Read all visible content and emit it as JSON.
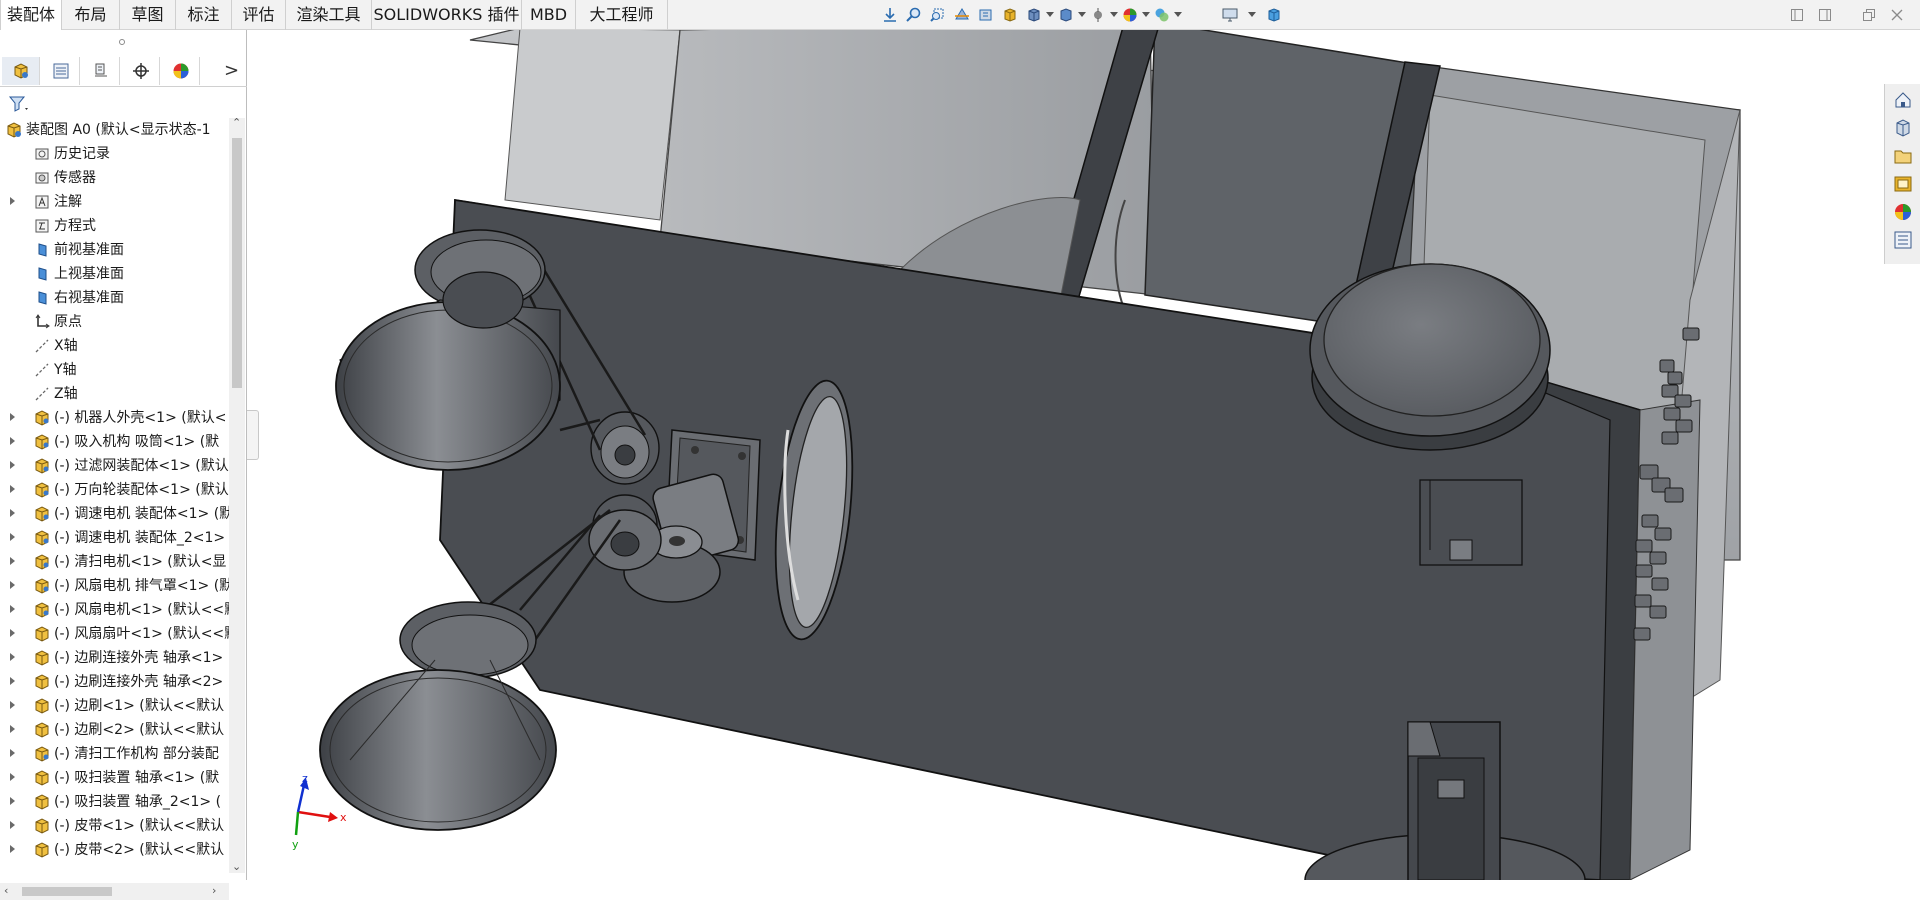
{
  "tabs": [
    {
      "label": "装配体",
      "active": true
    },
    {
      "label": "布局"
    },
    {
      "label": "草图"
    },
    {
      "label": "标注"
    },
    {
      "label": "评估"
    },
    {
      "label": "渲染工具"
    },
    {
      "label": "SOLIDWORKS 插件"
    },
    {
      "label": "MBD"
    },
    {
      "label": "大工程师"
    }
  ],
  "heads_up_toolbar": [
    "zoom-to-fit-icon",
    "zoom-to-area-icon",
    "previous-view-icon",
    "section-view-icon",
    "dynamic-annotation-icon",
    "view-orientation-icon",
    "display-style-icon",
    "hide-show-icon",
    "edit-appearance-icon",
    "apply-scene-icon",
    "view-settings-icon",
    "3d-view-icon"
  ],
  "window_controls": [
    "restore-icon",
    "tile-icon",
    "maximize-icon",
    "close-icon"
  ],
  "feature_manager": {
    "tab_icons": [
      "feature-manager-tree-icon",
      "property-manager-icon",
      "configuration-manager-icon",
      "dimxpert-icon",
      "display-manager-icon"
    ],
    "more_label": ">",
    "filter_icon": "filter-icon"
  },
  "tree": [
    {
      "label": "装配图 A0  (默认<显示状态-1",
      "icon": "assembly-icon",
      "level": 0
    },
    {
      "label": "历史记录",
      "icon": "history-icon",
      "level": 1
    },
    {
      "label": "传感器",
      "icon": "sensor-icon",
      "level": 1
    },
    {
      "label": "注解",
      "icon": "annotation-icon",
      "level": 1,
      "expandable": true
    },
    {
      "label": "方程式",
      "icon": "equation-icon",
      "level": 1
    },
    {
      "label": "前视基准面",
      "icon": "plane-icon",
      "level": 1
    },
    {
      "label": "上视基准面",
      "icon": "plane-icon",
      "level": 1
    },
    {
      "label": "右视基准面",
      "icon": "plane-icon",
      "level": 1
    },
    {
      "label": "原点",
      "icon": "origin-icon",
      "level": 1
    },
    {
      "label": "X轴",
      "icon": "axis-icon",
      "level": 1
    },
    {
      "label": "Y轴",
      "icon": "axis-icon",
      "level": 1
    },
    {
      "label": "Z轴",
      "icon": "axis-icon",
      "level": 1
    },
    {
      "label": "(-) 机器人外壳<1> (默认<",
      "icon": "subassembly-icon",
      "level": 1,
      "expandable": true
    },
    {
      "label": "(-) 吸入机构  吸筒<1> (默",
      "icon": "subassembly-icon",
      "level": 1,
      "expandable": true
    },
    {
      "label": "(-) 过滤网装配体<1> (默认",
      "icon": "subassembly-icon",
      "level": 1,
      "expandable": true
    },
    {
      "label": "(-) 万向轮装配体<1> (默认",
      "icon": "subassembly-icon",
      "level": 1,
      "expandable": true
    },
    {
      "label": "(-) 调速电机 装配体<1> (默",
      "icon": "subassembly-icon",
      "level": 1,
      "expandable": true
    },
    {
      "label": "(-) 调速电机 装配体_2<1>",
      "icon": "subassembly-icon",
      "level": 1,
      "expandable": true
    },
    {
      "label": "(-) 清扫电机<1> (默认<显",
      "icon": "subassembly-icon",
      "level": 1,
      "expandable": true
    },
    {
      "label": "(-) 风扇电机 排气罩<1> (默",
      "icon": "subassembly-icon",
      "level": 1,
      "expandable": true
    },
    {
      "label": "(-) 风扇电机<1> (默认<<默",
      "icon": "subassembly-icon",
      "level": 1,
      "expandable": true
    },
    {
      "label": "(-) 风扇扇叶<1> (默认<<默",
      "icon": "part-icon",
      "level": 1,
      "expandable": true
    },
    {
      "label": "(-) 边刷连接外壳 轴承<1>",
      "icon": "part-icon",
      "level": 1,
      "expandable": true
    },
    {
      "label": "(-) 边刷连接外壳 轴承<2>",
      "icon": "part-icon",
      "level": 1,
      "expandable": true
    },
    {
      "label": "(-) 边刷<1> (默认<<默认",
      "icon": "part-icon",
      "level": 1,
      "expandable": true
    },
    {
      "label": "(-) 边刷<2> (默认<<默认",
      "icon": "part-icon",
      "level": 1,
      "expandable": true
    },
    {
      "label": "(-) 清扫工作机构 部分装配",
      "icon": "subassembly-icon",
      "level": 1,
      "expandable": true
    },
    {
      "label": "(-) 吸扫装置  轴承<1> (默",
      "icon": "part-icon",
      "level": 1,
      "expandable": true
    },
    {
      "label": "(-) 吸扫装置  轴承_2<1> (",
      "icon": "part-icon",
      "level": 1,
      "expandable": true
    },
    {
      "label": "(-) 皮带<1> (默认<<默认",
      "icon": "part-icon",
      "level": 1,
      "expandable": true
    },
    {
      "label": "(-) 皮带<2> (默认<<默认",
      "icon": "part-icon",
      "level": 1,
      "expandable": true
    }
  ],
  "task_pane": [
    "solidworks-resources-icon",
    "design-library-icon",
    "file-explorer-icon",
    "view-palette-icon",
    "appearances-icon",
    "custom-properties-icon"
  ],
  "triad": {
    "x_label": "x",
    "y_label": "y",
    "z_label": "z"
  },
  "colors": {
    "body": "#4a4d52",
    "edge": "#1e1e1e",
    "glass": "#aeb0b3",
    "accent_x": "#e01010",
    "accent_y": "#10a010",
    "accent_z": "#1030d0"
  }
}
